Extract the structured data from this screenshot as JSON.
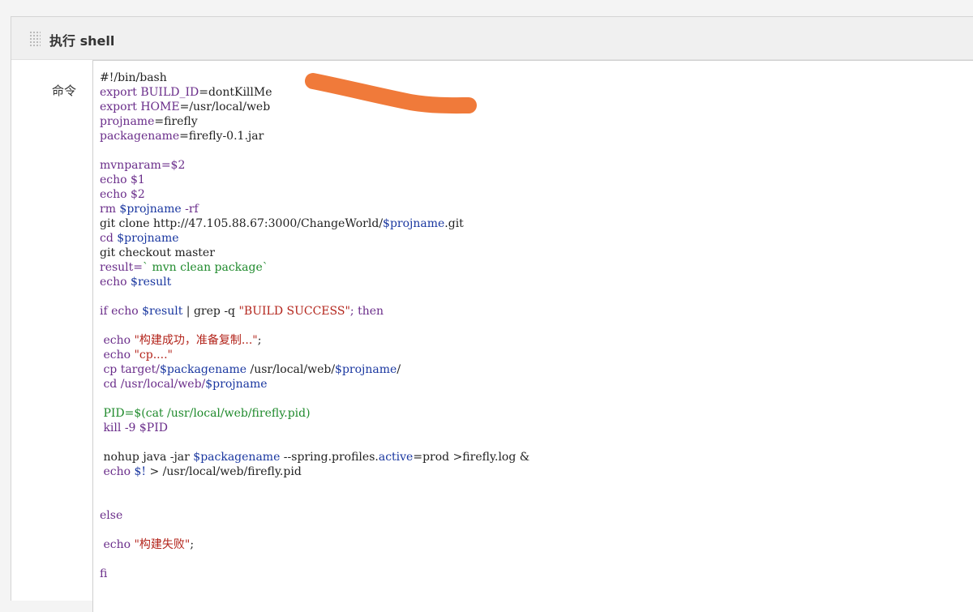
{
  "panel": {
    "title": "执行 shell",
    "label": "命令"
  },
  "code_lines": [
    [
      {
        "t": "#!/bin/bash",
        "c": "plain"
      }
    ],
    [
      {
        "t": "export BUILD_ID",
        "c": "kw"
      },
      {
        "t": "=dontKillMe",
        "c": "plain"
      }
    ],
    [
      {
        "t": "export HOME",
        "c": "kw"
      },
      {
        "t": "=/usr/local/web",
        "c": "plain"
      }
    ],
    [
      {
        "t": "projname",
        "c": "kw"
      },
      {
        "t": "=firefly",
        "c": "plain"
      }
    ],
    [
      {
        "t": "packagename",
        "c": "kw"
      },
      {
        "t": "=firefly-0.1.jar",
        "c": "plain"
      }
    ],
    [],
    [
      {
        "t": "mvnparam=$2",
        "c": "kw"
      }
    ],
    [
      {
        "t": "echo $1",
        "c": "kw"
      }
    ],
    [
      {
        "t": "echo $2",
        "c": "kw"
      }
    ],
    [
      {
        "t": "rm ",
        "c": "kw"
      },
      {
        "t": "$projname",
        "c": "var"
      },
      {
        "t": " -rf",
        "c": "kw"
      }
    ],
    [
      {
        "t": "git clone http://47.105.88.67:3000/ChangeWorld/",
        "c": "plain"
      },
      {
        "t": "$projname",
        "c": "var"
      },
      {
        "t": ".git",
        "c": "plain"
      }
    ],
    [
      {
        "t": "cd ",
        "c": "kw"
      },
      {
        "t": "$projname",
        "c": "var"
      }
    ],
    [
      {
        "t": "git checkout master",
        "c": "plain"
      }
    ],
    [
      {
        "t": "result=",
        "c": "kw"
      },
      {
        "t": "` mvn clean package`",
        "c": "cmd"
      }
    ],
    [
      {
        "t": "echo ",
        "c": "kw"
      },
      {
        "t": "$result",
        "c": "var"
      }
    ],
    [],
    [
      {
        "t": "if echo ",
        "c": "kw"
      },
      {
        "t": "$result",
        "c": "var"
      },
      {
        "t": " | grep -q ",
        "c": "plain"
      },
      {
        "t": "\"BUILD SUCCESS\"",
        "c": "str"
      },
      {
        "t": "; then",
        "c": "kw"
      }
    ],
    [],
    [
      {
        "t": " echo ",
        "c": "kw"
      },
      {
        "t": "\"构建成功，准备复制...\"",
        "c": "str"
      },
      {
        "t": ";",
        "c": "plain"
      }
    ],
    [
      {
        "t": " echo ",
        "c": "kw"
      },
      {
        "t": "\"cp....\"",
        "c": "str"
      }
    ],
    [
      {
        "t": " cp target/",
        "c": "kw"
      },
      {
        "t": "$packagename",
        "c": "var"
      },
      {
        "t": " /usr/local/web/",
        "c": "plain"
      },
      {
        "t": "$projname",
        "c": "var"
      },
      {
        "t": "/",
        "c": "plain"
      }
    ],
    [
      {
        "t": " cd /usr/local/web/",
        "c": "kw"
      },
      {
        "t": "$projname",
        "c": "var"
      }
    ],
    [],
    [
      {
        "t": " PID=$(cat /usr/local/web/firefly.pid)",
        "c": "cmd"
      }
    ],
    [
      {
        "t": " kill -9 $PID",
        "c": "kw"
      }
    ],
    [],
    [
      {
        "t": " nohup java -jar ",
        "c": "plain"
      },
      {
        "t": "$packagename",
        "c": "var"
      },
      {
        "t": " --spring.",
        "c": "plain"
      },
      {
        "t": "profiles",
        "c": "plain"
      },
      {
        "t": ".",
        "c": "plain"
      },
      {
        "t": "active",
        "c": "var"
      },
      {
        "t": "=prod >firefly.log &",
        "c": "plain"
      }
    ],
    [
      {
        "t": " echo ",
        "c": "kw"
      },
      {
        "t": "$!",
        "c": "var"
      },
      {
        "t": " > /usr/local/web/firefly.pid",
        "c": "plain"
      }
    ],
    [],
    [],
    [
      {
        "t": "else",
        "c": "kw"
      }
    ],
    [],
    [
      {
        "t": " echo ",
        "c": "kw"
      },
      {
        "t": "\"构建失败\"",
        "c": "str"
      },
      {
        "t": ";",
        "c": "plain"
      }
    ],
    [],
    [
      {
        "t": "fi",
        "c": "kw"
      }
    ]
  ],
  "colors": {
    "keyword": "#6a2d8a",
    "variable": "#1a37a0",
    "string": "#b3241b",
    "command": "#1f8a2c",
    "scribble": "#f07a3a"
  }
}
